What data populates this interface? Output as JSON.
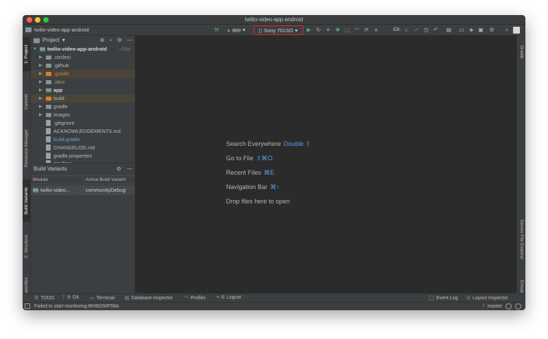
{
  "window": {
    "title": "twilio-video-app-android"
  },
  "toolbar": {
    "project_name": "twilio-video-app-android",
    "run_config": "app",
    "device": "Sony 701SO",
    "git_label": "Git:"
  },
  "left_tabs": [
    "1: Project",
    "Commit",
    "Resource Manager",
    "Build Variants",
    "Z: Structure",
    "2: Favorites"
  ],
  "right_tabs": [
    "Gradle",
    "Device File Explorer",
    "Emulator"
  ],
  "project_panel": {
    "title": "Project",
    "root": "twilio-video-app-android",
    "root_path": "~/Stu",
    "items": [
      {
        "label": ".circleci",
        "kind": "folder"
      },
      {
        "label": ".github",
        "kind": "folder"
      },
      {
        "label": ".gradle",
        "kind": "folder-excluded"
      },
      {
        "label": ".idea",
        "kind": "folder"
      },
      {
        "label": "app",
        "kind": "module"
      },
      {
        "label": "build",
        "kind": "folder-excluded"
      },
      {
        "label": "gradle",
        "kind": "folder"
      },
      {
        "label": "images",
        "kind": "folder"
      },
      {
        "label": ".gitignore",
        "kind": "file"
      },
      {
        "label": "ACKNOWLEDGEMENTS.md",
        "kind": "file"
      },
      {
        "label": "build.gradle",
        "kind": "file"
      },
      {
        "label": "CHANGELOG.md",
        "kind": "file"
      },
      {
        "label": "gradle.properties",
        "kind": "file"
      },
      {
        "label": "gradlew",
        "kind": "file"
      }
    ]
  },
  "build_variants": {
    "title": "Build Variants",
    "col_module": "Module",
    "col_variant": "Active Build Variant",
    "rows": [
      {
        "module": "twilio-video...",
        "variant": "communityDebug"
      }
    ]
  },
  "editor_hints": [
    {
      "label": "Search Everywhere",
      "key": "Double ⇧"
    },
    {
      "label": "Go to File",
      "key": "⇧⌘O"
    },
    {
      "label": "Recent Files",
      "key": "⌘E"
    },
    {
      "label": "Navigation Bar",
      "key": "⌘↑"
    },
    {
      "label": "Drop files here to open",
      "key": ""
    }
  ],
  "bottom_tools": {
    "todo": "TODO",
    "git": "9: Git",
    "terminal": "Terminal",
    "db": "Database Inspector",
    "profiler": "Profiler",
    "logcat": "6: Logcat",
    "event_log": "Event Log",
    "layout_inspector": "Layout Inspector"
  },
  "status": {
    "message": "Failed to start monitoring BH902WF59A",
    "branch": "master"
  },
  "colors": {
    "accent_key": "#589df6",
    "highlight_border": "#e0261f",
    "excluded_folder": "#cf7f36"
  }
}
